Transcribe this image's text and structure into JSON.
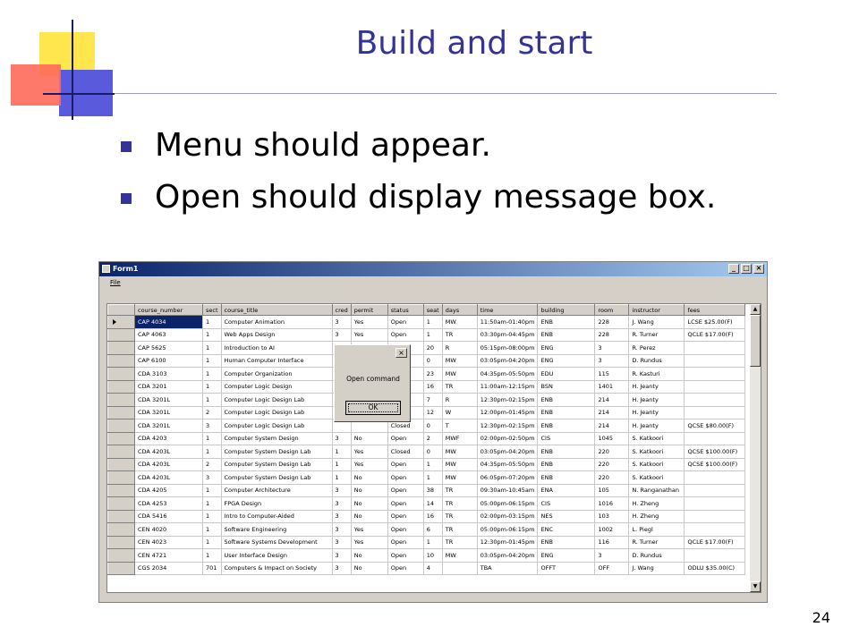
{
  "slide": {
    "title": "Build and start",
    "bullets": [
      "Menu should appear.",
      "Open should display message box."
    ],
    "page_number": "24"
  },
  "window": {
    "title": "Form1",
    "menu": [
      "File"
    ],
    "buttons": {
      "minimize": "_",
      "maximize": "□",
      "close": "×"
    }
  },
  "grid": {
    "columns": [
      "course_number",
      "sect",
      "course_title",
      "cred",
      "permit",
      "status",
      "seat",
      "days",
      "time",
      "building",
      "room",
      "instructor",
      "fees"
    ],
    "rows": [
      [
        "CAP 4034",
        "1",
        "Computer Animation",
        "3",
        "Yes",
        "Open",
        "1",
        "MW",
        "11:50am-01:40pm",
        "ENB",
        "228",
        "J. Wang",
        "LCSE $25.00(F)"
      ],
      [
        "CAP 4063",
        "1",
        "Web Apps Design",
        "3",
        "Yes",
        "Open",
        "1",
        "TR",
        "03:30pm-04:45pm",
        "ENB",
        "228",
        "R. Turner",
        "QCLE $17.00(F)"
      ],
      [
        "CAP 5625",
        "1",
        "Introduction to AI",
        "",
        "",
        "",
        "20",
        "R",
        "05:15pm-08:00pm",
        "ENG",
        "3",
        "R. Perez",
        ""
      ],
      [
        "CAP 6100",
        "1",
        "Human Computer Interface",
        "",
        "",
        "",
        "0",
        "MW",
        "03:05pm-04:20pm",
        "ENG",
        "3",
        "D. Rundus",
        ""
      ],
      [
        "CDA 3103",
        "1",
        "Computer Organization",
        "",
        "",
        "",
        "23",
        "MW",
        "04:35pm-05:50pm",
        "EDU",
        "115",
        "R. Kasturi",
        ""
      ],
      [
        "CDA 3201",
        "1",
        "Computer Logic Design",
        "",
        "",
        "",
        "16",
        "TR",
        "11:00am-12:15pm",
        "BSN",
        "1401",
        "H. Jeanty",
        ""
      ],
      [
        "CDA 3201L",
        "1",
        "Computer Logic Design Lab",
        "",
        "",
        "",
        "7",
        "R",
        "12:30pm-02:15pm",
        "ENB",
        "214",
        "H. Jeanty",
        ""
      ],
      [
        "CDA 3201L",
        "2",
        "Computer Logic Design Lab",
        "",
        "",
        "",
        "12",
        "W",
        "12:00pm-01:45pm",
        "ENB",
        "214",
        "H. Jeanty",
        ""
      ],
      [
        "CDA 3201L",
        "3",
        "Computer Logic Design Lab",
        "",
        "",
        "Closed",
        "0",
        "T",
        "12:30pm-02:15pm",
        "ENB",
        "214",
        "H. Jeanty",
        "QCSE $80.00(F)"
      ],
      [
        "CDA 4203",
        "1",
        "Computer System Design",
        "3",
        "No",
        "Open",
        "2",
        "MWF",
        "02:00pm-02:50pm",
        "CIS",
        "1045",
        "S. Katkoori",
        ""
      ],
      [
        "CDA 4203L",
        "1",
        "Computer System Design Lab",
        "1",
        "Yes",
        "Closed",
        "0",
        "MW",
        "03:05pm-04:20pm",
        "ENB",
        "220",
        "S. Katkoori",
        "QCSE $100.00(F)"
      ],
      [
        "CDA 4203L",
        "2",
        "Computer System Design Lab",
        "1",
        "Yes",
        "Open",
        "1",
        "MW",
        "04:35pm-05:50pm",
        "ENB",
        "220",
        "S. Katkoori",
        "QCSE $100.00(F)"
      ],
      [
        "CDA 4203L",
        "3",
        "Computer System Design Lab",
        "1",
        "No",
        "Open",
        "1",
        "MW",
        "06:05pm-07:20pm",
        "ENB",
        "220",
        "S. Katkoori",
        ""
      ],
      [
        "CDA 4205",
        "1",
        "Computer Architecture",
        "3",
        "No",
        "Open",
        "38",
        "TR",
        "09:30am-10:45am",
        "ENA",
        "105",
        "N. Ranganathan",
        ""
      ],
      [
        "CDA 4253",
        "1",
        "FPGA Design",
        "3",
        "No",
        "Open",
        "14",
        "TR",
        "05:00pm-06:15pm",
        "CIS",
        "1016",
        "H. Zheng",
        ""
      ],
      [
        "CDA 5416",
        "1",
        "Intro to Computer-Aided",
        "3",
        "No",
        "Open",
        "16",
        "TR",
        "02:00pm-03:15pm",
        "NES",
        "103",
        "H. Zheng",
        ""
      ],
      [
        "CEN 4020",
        "1",
        "Software Engineering",
        "3",
        "Yes",
        "Open",
        "6",
        "TR",
        "05:00pm-06:15pm",
        "ENC",
        "1002",
        "L. Piegl",
        ""
      ],
      [
        "CEN 4023",
        "1",
        "Software Systems Development",
        "3",
        "Yes",
        "Open",
        "1",
        "TR",
        "12:30pm-01:45pm",
        "ENB",
        "116",
        "R. Turner",
        "QCLE $17.00(F)"
      ],
      [
        "CEN 4721",
        "1",
        "User Interface Design",
        "3",
        "No",
        "Open",
        "10",
        "MW",
        "03:05pm-04:20pm",
        "ENG",
        "3",
        "D. Rundus",
        ""
      ],
      [
        "CGS 2034",
        "701",
        "Computers & Impact on Society",
        "3",
        "No",
        "Open",
        "4",
        "",
        "TBA",
        "OFFT",
        "OFF",
        "J. Wang",
        "ODLU $35.00(C)"
      ]
    ]
  },
  "dialog": {
    "message": "Open command",
    "ok_label": "OK",
    "close_label": "×"
  }
}
